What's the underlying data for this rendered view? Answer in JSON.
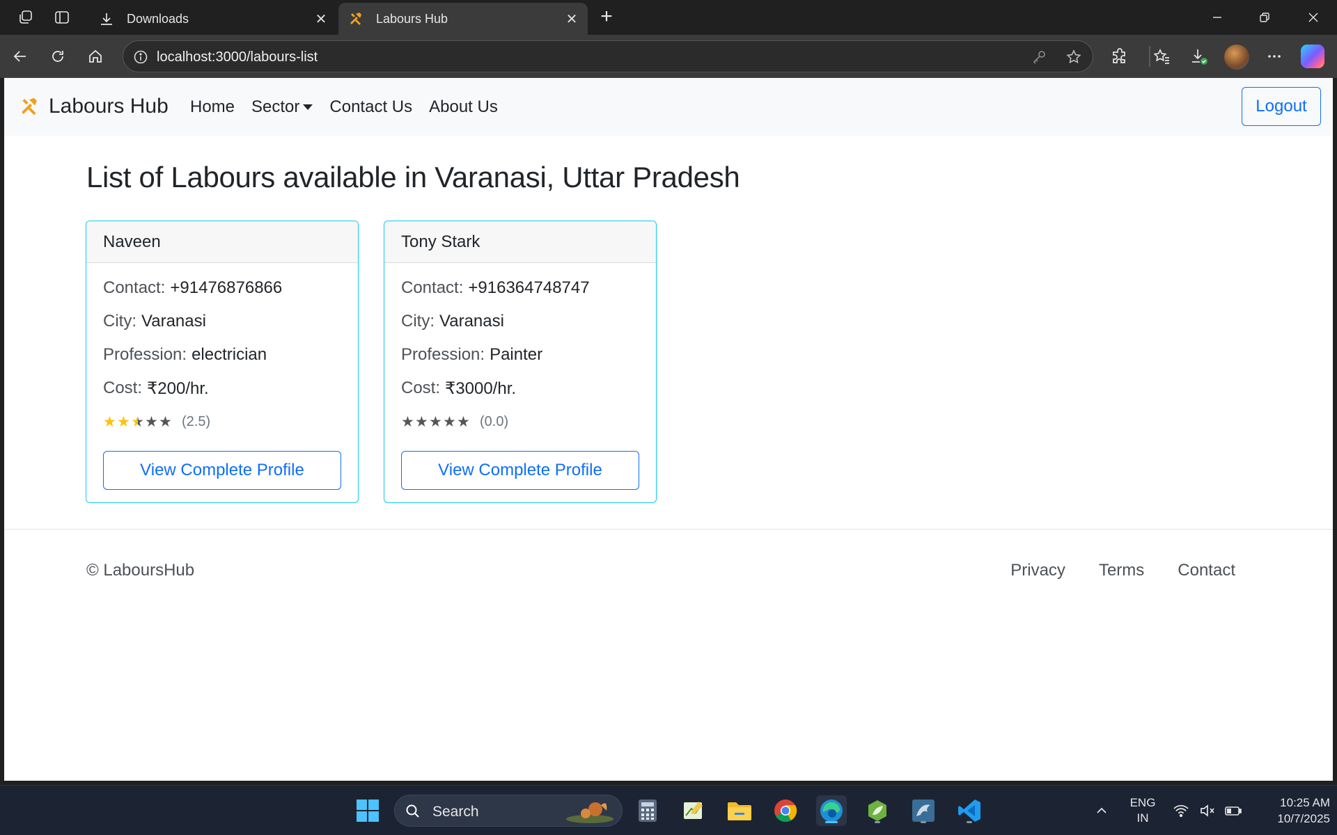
{
  "browser": {
    "tabs": [
      {
        "title": "Downloads",
        "icon": "download-icon",
        "active": false
      },
      {
        "title": "Labours Hub",
        "icon": "tools-icon",
        "active": true
      }
    ],
    "url": "localhost:3000/labours-list"
  },
  "navbar": {
    "brand": "Labours Hub",
    "links": {
      "home": "Home",
      "sector": "Sector",
      "contact": "Contact Us",
      "about": "About Us"
    },
    "logout": "Logout"
  },
  "main": {
    "title": "List of Labours available in Varanasi, Uttar Pradesh",
    "labels": {
      "contact": "Contact:",
      "city": "City:",
      "profession": "Profession:",
      "cost": "Cost:"
    },
    "labours": [
      {
        "name": "Naveen",
        "contact": "+91476876866",
        "city": "Varanasi",
        "profession": "electrician",
        "cost": "₹200/hr.",
        "rating": 2.5,
        "rating_text": "(2.5)",
        "button": "View Complete Profile"
      },
      {
        "name": "Tony Stark",
        "contact": "+916364748747",
        "city": "Varanasi",
        "profession": "Painter",
        "cost": "₹3000/hr.",
        "rating": 0,
        "rating_text": "(0.0)",
        "button": "View Complete Profile"
      }
    ]
  },
  "footer": {
    "copyright": "© LaboursHub",
    "links": {
      "privacy": "Privacy",
      "terms": "Terms",
      "contact": "Contact"
    }
  },
  "taskbar": {
    "search_placeholder": "Search",
    "lang_line1": "ENG",
    "lang_line2": "IN",
    "time": "10:25 AM",
    "date": "10/7/2025"
  },
  "colors": {
    "primary": "#0d6efd",
    "card_border": "#0dcaf0",
    "star": "#ffc107",
    "brand_icon": "#f0a020"
  }
}
